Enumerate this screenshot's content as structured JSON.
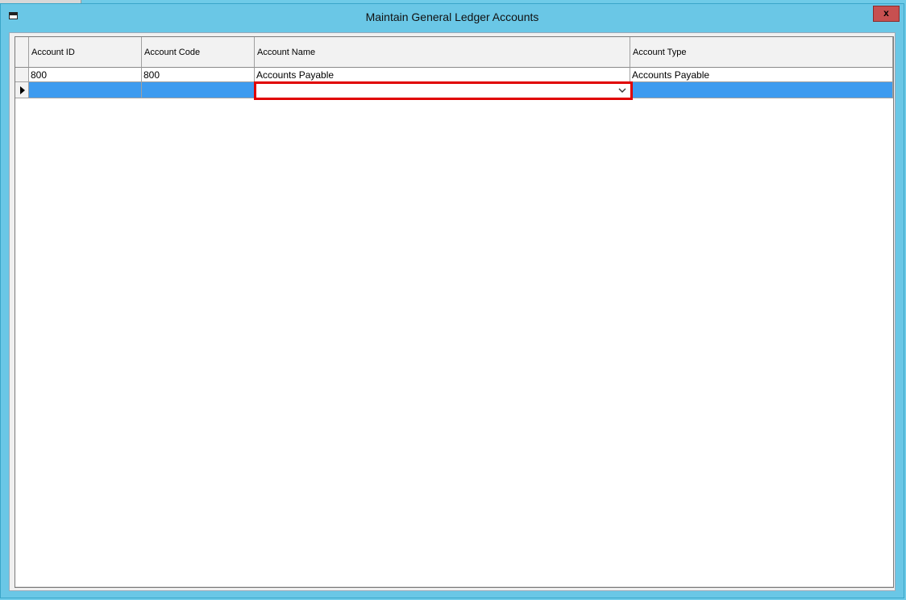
{
  "window": {
    "title": "Maintain General Ledger Accounts",
    "close_label": "x"
  },
  "grid": {
    "columns": [
      "Account ID",
      "Account Code",
      "Account Name",
      "Account Type"
    ],
    "rows": [
      {
        "account_id": "800",
        "account_code": "800",
        "account_name": "Accounts Payable",
        "account_type": "Accounts Payable"
      }
    ],
    "new_row": {
      "account_id": "",
      "account_code": "",
      "account_name": "",
      "account_type": ""
    }
  },
  "colors": {
    "title_bar": "#6ac7e6",
    "selected_row": "#3d9bef",
    "highlight_border": "#e00000",
    "close_button": "#c75050"
  },
  "icons": {
    "window_icon": "window-icon",
    "row_indicator": "current-row-arrow-icon",
    "dropdown": "chevron-down-icon"
  }
}
